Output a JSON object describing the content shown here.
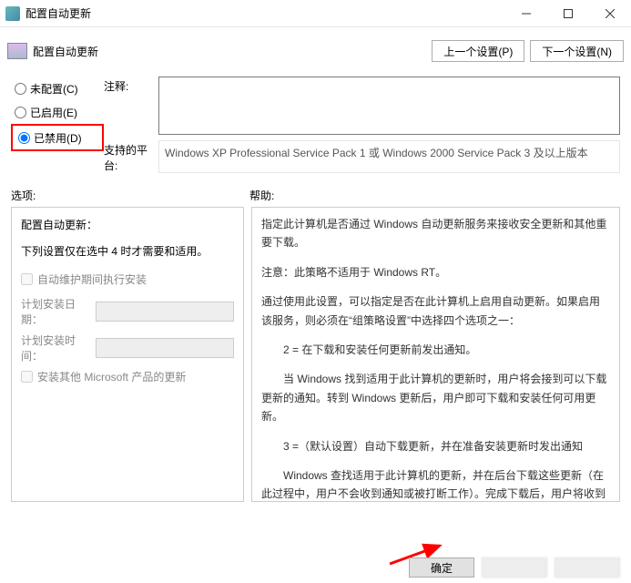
{
  "title": "配置自动更新",
  "header": {
    "label": "配置自动更新"
  },
  "nav": {
    "prev": "上一个设置(P)",
    "next": "下一个设置(N)"
  },
  "radios": {
    "not_configured": "未配置(C)",
    "enabled": "已启用(E)",
    "disabled": "已禁用(D)"
  },
  "labels": {
    "comment": "注释:",
    "platform": "支持的平台:",
    "options": "选项:",
    "help": "帮助:"
  },
  "platform_text": "Windows XP Professional Service Pack 1 或 Windows 2000 Service Pack 3 及以上版本",
  "options": {
    "title": "配置自动更新：",
    "note": "下列设置仅在选中 4 时才需要和适用。",
    "chk_maint": "自动维护期间执行安装",
    "sched_day": "计划安装日期：",
    "sched_time": "计划安装时间：",
    "chk_ms": "安装其他 Microsoft 产品的更新"
  },
  "help": {
    "p1": "指定此计算机是否通过 Windows 自动更新服务来接收安全更新和其他重要下载。",
    "p2": "注意：此策略不适用于 Windows RT。",
    "p3": "通过使用此设置，可以指定是否在此计算机上启用自动更新。如果启用该服务，则必须在“组策略设置”中选择四个选项之一：",
    "p4": "2 = 在下载和安装任何更新前发出通知。",
    "p5": "当 Windows 找到适用于此计算机的更新时，用户将会接到可以下载更新的通知。转到 Windows 更新后，用户即可下载和安装任何可用更新。",
    "p6": "3 =（默认设置）自动下载更新，并在准备安装更新时发出通知",
    "p7": "Windows 查找适用于此计算机的更新，并在后台下载这些更新（在此过程中，用户不会收到通知或被打断工作）。完成下载后，用户将收到可以安装更新的通知。转到 Windows 更新后，"
  },
  "footer": {
    "ok": "确定"
  }
}
